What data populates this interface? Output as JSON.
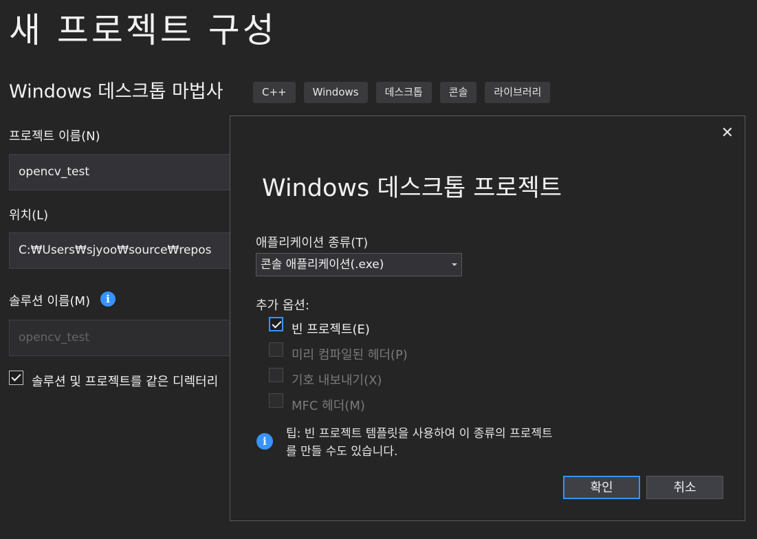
{
  "page": {
    "title": "새 프로젝트 구성",
    "template_name": "Windows 데스크톱 마법사",
    "tags": [
      "C++",
      "Windows",
      "데스크톱",
      "콘솔",
      "라이브러리"
    ]
  },
  "form": {
    "project_name_label": "프로젝트 이름(N)",
    "project_name_value": "opencv_test",
    "location_label": "위치(L)",
    "location_value": "C:₩Users₩sjyoo₩source₩repos",
    "solution_name_label": "솔루션 이름(M)",
    "solution_name_value": "opencv_test",
    "same_dir_label": "솔루션 및 프로젝트를 같은 디렉터리",
    "same_dir_checked": true
  },
  "dialog": {
    "title": "Windows 데스크톱 프로젝트",
    "close_glyph": "✕",
    "app_type_label": "애플리케이션 종류(T)",
    "app_type_value": "콘솔 애플리케이션(.exe)",
    "extra_options_label": "추가 옵션:",
    "options": [
      {
        "label": "빈 프로젝트(E)",
        "checked": true,
        "enabled": true
      },
      {
        "label": "미리 컴파일된 헤더(P)",
        "checked": false,
        "enabled": false
      },
      {
        "label": "기호 내보내기(X)",
        "checked": false,
        "enabled": false
      },
      {
        "label": "MFC 헤더(M)",
        "checked": false,
        "enabled": false
      }
    ],
    "tip_line1": "팁: 빈 프로젝트 템플릿을 사용하여 이 종류의 프로젝트",
    "tip_line2": "를 만들 수도 있습니다.",
    "ok_label": "확인",
    "cancel_label": "취소"
  },
  "colors": {
    "background": "#252526",
    "accent": "#3794ff"
  }
}
